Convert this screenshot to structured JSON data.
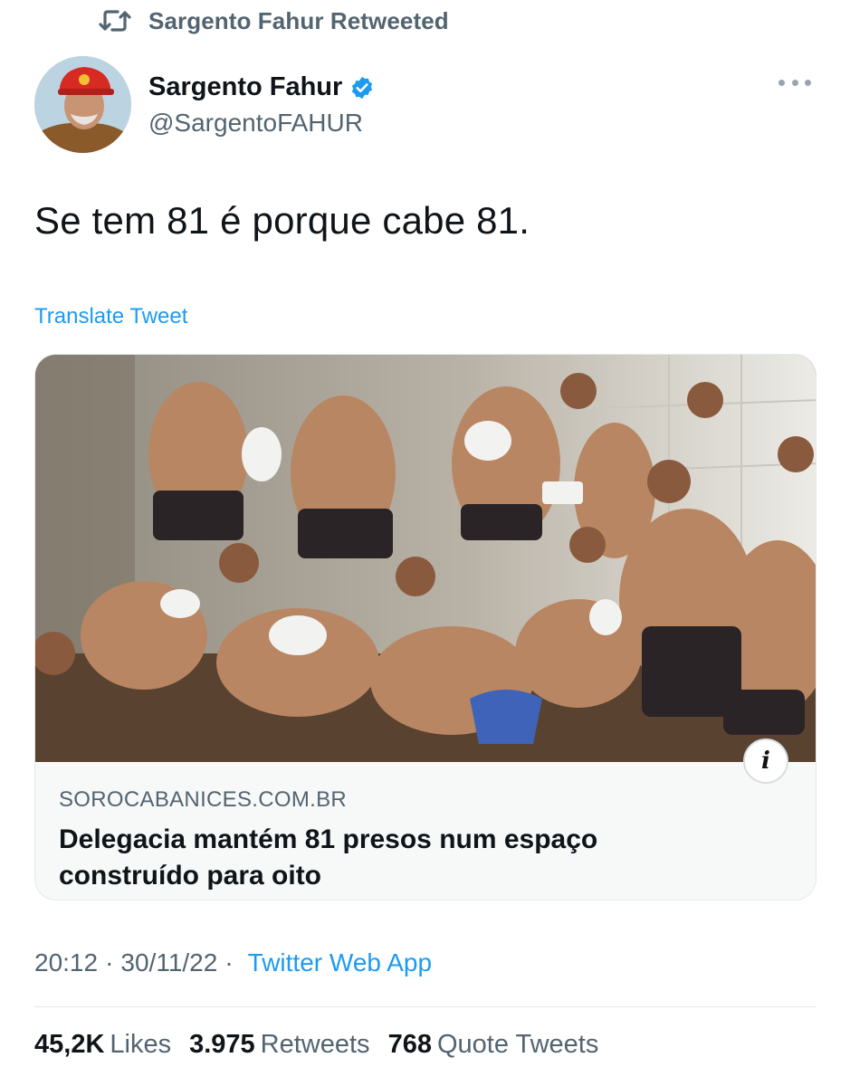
{
  "retweet_banner": {
    "icon": "retweet-icon",
    "label": "Sargento Fahur Retweeted"
  },
  "author": {
    "display_name": "Sargento Fahur",
    "handle": "@SargentoFAHUR",
    "verified": true
  },
  "tweet": {
    "text": "Se tem 81 é porque cabe 81.",
    "translate_label": "Translate Tweet"
  },
  "link_card": {
    "domain": "SOROCABANICES.COM.BR",
    "title_line1": "Delegacia mantém 81 presos num espaço",
    "title_line2": "construído para oito",
    "info_icon": "i"
  },
  "meta": {
    "time": "20:12",
    "date": "30/11/22",
    "separator": "·",
    "source": "Twitter Web App"
  },
  "stats": [
    {
      "value": "45,2K",
      "label": "Likes"
    },
    {
      "value": "3.975",
      "label": "Retweets"
    },
    {
      "value": "768",
      "label": "Quote Tweets"
    }
  ],
  "colors": {
    "accent": "#1d9bf0",
    "secondary_text": "#536471",
    "primary_text": "#0f1419"
  }
}
